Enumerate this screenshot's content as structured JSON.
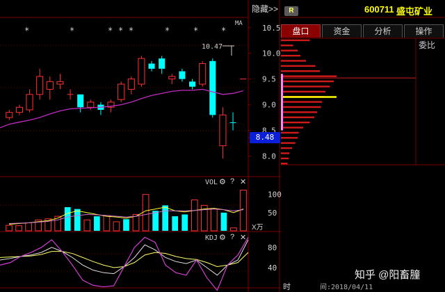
{
  "header": {
    "hide_label": "隐藏>>",
    "badge": "R",
    "stock_code": "600711",
    "stock_name": "盛屯矿业"
  },
  "tabs": [
    {
      "label": "盘口",
      "active": true
    },
    {
      "label": "资金",
      "active": false
    },
    {
      "label": "分析",
      "active": false
    },
    {
      "label": "操作",
      "active": false
    }
  ],
  "weibi_label": "委比",
  "ma_label": "MA",
  "current_price": "8.48",
  "high_marker": "10.47",
  "price_axis": [
    "10.5",
    "10.0",
    "9.5",
    "9.0",
    "8.5",
    "8.0"
  ],
  "vol_panel": {
    "title": "VOL",
    "unit": "X万",
    "ticks": [
      "100",
      "50"
    ]
  },
  "kdj_panel": {
    "title": "KDJ",
    "ticks": [
      "80",
      "40"
    ]
  },
  "footer": {
    "time_label": "时",
    "time_value": "间:2018/04/11"
  },
  "watermark": "知乎 @阳畜膧",
  "colors": {
    "up": "#ff3232",
    "down": "#00ffff",
    "ma_line": "#c02bc0",
    "vol_ma1": "#ffff33",
    "vol_ma2": "#d070d0",
    "grid": "#7a0000",
    "profile_highlight": "#ffff00"
  },
  "chart_data": {
    "type": "candlestick",
    "price_axis_range": [
      7.6,
      10.7
    ],
    "candles": [
      {
        "o": 8.75,
        "c": 8.85,
        "h": 8.9,
        "l": 8.7,
        "up": true
      },
      {
        "o": 8.85,
        "c": 8.95,
        "h": 9.0,
        "l": 8.8,
        "up": true
      },
      {
        "o": 8.9,
        "c": 9.2,
        "h": 9.3,
        "l": 8.85,
        "up": true
      },
      {
        "o": 9.2,
        "c": 9.55,
        "h": 9.7,
        "l": 9.1,
        "up": true
      },
      {
        "o": 9.3,
        "c": 9.45,
        "h": 9.55,
        "l": 9.1,
        "up": true
      },
      {
        "o": 9.4,
        "c": 9.45,
        "h": 9.6,
        "l": 9.3,
        "up": true
      },
      {
        "o": 9.2,
        "c": 9.2,
        "h": 9.3,
        "l": 9.1,
        "up": true
      },
      {
        "o": 9.2,
        "c": 8.95,
        "h": 9.2,
        "l": 8.85,
        "up": false
      },
      {
        "o": 8.95,
        "c": 9.05,
        "h": 9.1,
        "l": 8.9,
        "up": true
      },
      {
        "o": 9.0,
        "c": 8.9,
        "h": 9.05,
        "l": 8.8,
        "up": false
      },
      {
        "o": 8.95,
        "c": 9.05,
        "h": 9.1,
        "l": 8.85,
        "up": true
      },
      {
        "o": 9.1,
        "c": 9.4,
        "h": 9.45,
        "l": 9.05,
        "up": true
      },
      {
        "o": 9.3,
        "c": 9.5,
        "h": 9.55,
        "l": 9.2,
        "up": true
      },
      {
        "o": 9.4,
        "c": 9.9,
        "h": 9.95,
        "l": 9.35,
        "up": true
      },
      {
        "o": 9.8,
        "c": 9.7,
        "h": 9.85,
        "l": 9.65,
        "up": false
      },
      {
        "o": 9.9,
        "c": 9.7,
        "h": 9.95,
        "l": 9.6,
        "up": false
      },
      {
        "o": 9.5,
        "c": 9.55,
        "h": 9.6,
        "l": 9.4,
        "up": true
      },
      {
        "o": 9.65,
        "c": 9.5,
        "h": 9.7,
        "l": 9.45,
        "up": false
      },
      {
        "o": 9.45,
        "c": 9.35,
        "h": 9.5,
        "l": 9.3,
        "up": false
      },
      {
        "o": 9.4,
        "c": 9.8,
        "h": 9.85,
        "l": 9.35,
        "up": true
      },
      {
        "o": 9.85,
        "c": 8.8,
        "h": 9.9,
        "l": 8.75,
        "up": false
      },
      {
        "o": 8.8,
        "c": 8.2,
        "h": 8.95,
        "l": 7.95,
        "up": true
      },
      {
        "o": 8.65,
        "c": 8.65,
        "h": 8.85,
        "l": 8.5,
        "up": false
      },
      {
        "o": 9.5,
        "c": 9.5,
        "h": 9.5,
        "l": 9.5,
        "up": true
      }
    ],
    "ma": [
      8.62,
      8.66,
      8.7,
      8.75,
      8.82,
      8.88,
      8.92,
      8.93,
      8.94,
      8.95,
      8.97,
      9.0,
      9.05,
      9.12,
      9.18,
      9.22,
      9.26,
      9.28,
      9.28,
      9.3,
      9.25,
      9.2,
      9.22,
      9.27
    ],
    "volume": [
      {
        "v": 15,
        "up": true
      },
      {
        "v": 14,
        "up": true
      },
      {
        "v": 22,
        "up": true
      },
      {
        "v": 30,
        "up": true
      },
      {
        "v": 33,
        "up": true
      },
      {
        "v": 40,
        "up": true
      },
      {
        "v": 65,
        "up": false
      },
      {
        "v": 60,
        "up": false
      },
      {
        "v": 30,
        "up": true
      },
      {
        "v": 40,
        "up": false
      },
      {
        "v": 42,
        "up": true
      },
      {
        "v": 25,
        "up": true
      },
      {
        "v": 32,
        "up": false
      },
      {
        "v": 45,
        "up": true
      },
      {
        "v": 100,
        "up": true
      },
      {
        "v": 55,
        "up": false
      },
      {
        "v": 70,
        "up": false
      },
      {
        "v": 40,
        "up": false
      },
      {
        "v": 45,
        "up": false
      },
      {
        "v": 85,
        "up": true
      },
      {
        "v": 70,
        "up": true
      },
      {
        "v": 60,
        "up": true
      },
      {
        "v": 50,
        "up": false
      },
      {
        "v": 8,
        "up": true
      },
      {
        "v": 112,
        "up": true
      }
    ],
    "vol_ma5": [
      18,
      20,
      22,
      25,
      28,
      35,
      48,
      55,
      50,
      45,
      40,
      38,
      35,
      40,
      55,
      60,
      65,
      55,
      52,
      56,
      60,
      62,
      58,
      50,
      60
    ],
    "vol_ma10": [
      20,
      21,
      22,
      24,
      26,
      30,
      38,
      42,
      45,
      44,
      42,
      40,
      38,
      40,
      45,
      50,
      55,
      55,
      55,
      56,
      58,
      60,
      58,
      55,
      58
    ],
    "vol_axis_range": [
      0,
      130
    ],
    "kdj_axis_range": [
      0,
      110
    ],
    "kdj_k": [
      55,
      58,
      62,
      65,
      70,
      80,
      72,
      60,
      45,
      35,
      30,
      28,
      42,
      60,
      85,
      75,
      60,
      52,
      48,
      55,
      40,
      25,
      45,
      55,
      95
    ],
    "kdj_d": [
      60,
      61,
      62,
      63,
      66,
      72,
      72,
      68,
      60,
      52,
      45,
      40,
      42,
      50,
      65,
      70,
      68,
      62,
      58,
      56,
      50,
      42,
      45,
      50,
      70
    ],
    "kdj_j": [
      45,
      50,
      62,
      70,
      80,
      95,
      72,
      45,
      15,
      5,
      2,
      4,
      42,
      80,
      100,
      90,
      45,
      30,
      25,
      55,
      20,
      -5,
      45,
      65,
      100
    ],
    "price_profile": [
      {
        "p": 10.45,
        "w": 0.58
      },
      {
        "p": 10.35,
        "w": 0.6
      },
      {
        "p": 10.25,
        "w": 0.52
      },
      {
        "p": 10.15,
        "w": 0.22
      },
      {
        "p": 10.05,
        "w": 0.3
      },
      {
        "p": 9.95,
        "w": 0.35
      },
      {
        "p": 9.85,
        "w": 0.45
      },
      {
        "p": 9.75,
        "w": 0.62
      },
      {
        "p": 9.65,
        "w": 0.7
      },
      {
        "p": 9.55,
        "w": 1.0
      },
      {
        "p": 9.45,
        "w": 0.95
      },
      {
        "p": 9.35,
        "w": 0.88
      },
      {
        "p": 9.25,
        "w": 0.8
      },
      {
        "p": 9.15,
        "w": 0.78
      },
      {
        "p": 9.05,
        "w": 0.74
      },
      {
        "p": 8.95,
        "w": 0.72
      },
      {
        "p": 8.85,
        "w": 0.65
      },
      {
        "p": 8.75,
        "w": 0.6
      },
      {
        "p": 8.65,
        "w": 0.52
      },
      {
        "p": 8.55,
        "w": 0.4
      },
      {
        "p": 8.45,
        "w": 0.32
      },
      {
        "p": 8.35,
        "w": 0.3
      },
      {
        "p": 8.25,
        "w": 0.26
      },
      {
        "p": 8.15,
        "w": 0.2
      },
      {
        "p": 8.05,
        "w": 0.15
      },
      {
        "p": 7.95,
        "w": 0.14
      },
      {
        "p": 7.85,
        "w": 0.12
      }
    ],
    "profile_highlight_price": 9.15
  }
}
